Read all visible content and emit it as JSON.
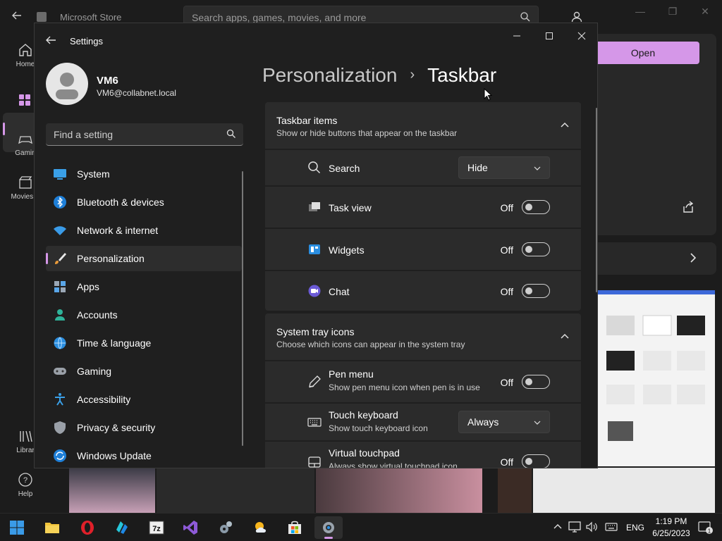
{
  "store": {
    "title": "Microsoft Store",
    "search_placeholder": "Search apps, games, movies, and more",
    "nav": [
      {
        "label": "Home",
        "icon": "home-icon"
      },
      {
        "label": "Apps",
        "icon": "apps-icon"
      },
      {
        "label": "Gamin",
        "icon": "gaming-controller-icon"
      },
      {
        "label": "Movies &",
        "icon": "movies-icon"
      },
      {
        "label": "Librar",
        "icon": "library-icon"
      },
      {
        "label": "Help",
        "icon": "help-icon"
      }
    ],
    "open_label": "Open",
    "accent_color": "#d597e8"
  },
  "settings": {
    "title": "Settings",
    "profile": {
      "name": "VM6",
      "email": "VM6@collabnet.local"
    },
    "search_placeholder": "Find a setting",
    "nav": [
      {
        "label": "System",
        "icon": "monitor-icon"
      },
      {
        "label": "Bluetooth & devices",
        "icon": "bluetooth-icon"
      },
      {
        "label": "Network & internet",
        "icon": "wifi-icon"
      },
      {
        "label": "Personalization",
        "icon": "brush-icon",
        "active": true
      },
      {
        "label": "Apps",
        "icon": "apps-icon"
      },
      {
        "label": "Accounts",
        "icon": "person-icon"
      },
      {
        "label": "Time & language",
        "icon": "globe-clock-icon"
      },
      {
        "label": "Gaming",
        "icon": "gamepad-icon"
      },
      {
        "label": "Accessibility",
        "icon": "accessibility-icon"
      },
      {
        "label": "Privacy & security",
        "icon": "shield-icon"
      },
      {
        "label": "Windows Update",
        "icon": "update-icon"
      }
    ],
    "breadcrumb": {
      "parent": "Personalization",
      "separator": "›",
      "current": "Taskbar"
    },
    "sections": {
      "taskbar_items": {
        "title": "Taskbar items",
        "subtitle": "Show or hide buttons that appear on the taskbar",
        "rows": [
          {
            "label": "Search",
            "icon": "search-icon",
            "control": "dropdown",
            "value": "Hide"
          },
          {
            "label": "Task view",
            "icon": "task-view-icon",
            "control": "toggle",
            "state": "Off"
          },
          {
            "label": "Widgets",
            "icon": "widgets-icon",
            "control": "toggle",
            "state": "Off"
          },
          {
            "label": "Chat",
            "icon": "chat-icon",
            "control": "toggle",
            "state": "Off"
          }
        ]
      },
      "system_tray": {
        "title": "System tray icons",
        "subtitle": "Choose which icons can appear in the system tray",
        "rows": [
          {
            "label": "Pen menu",
            "sublabel": "Show pen menu icon when pen is in use",
            "icon": "pen-icon",
            "control": "toggle",
            "state": "Off"
          },
          {
            "label": "Touch keyboard",
            "sublabel": "Show touch keyboard icon",
            "icon": "keyboard-icon",
            "control": "dropdown",
            "value": "Always"
          },
          {
            "label": "Virtual touchpad",
            "sublabel": "Always show virtual touchpad icon",
            "icon": "touchpad-icon",
            "control": "toggle",
            "state": "Off"
          }
        ]
      }
    }
  },
  "taskbar": {
    "apps": [
      {
        "name": "Start",
        "icon": "windows-start-icon"
      },
      {
        "name": "File Explorer",
        "icon": "folder-icon"
      },
      {
        "name": "Opera",
        "icon": "opera-icon"
      },
      {
        "name": "App",
        "icon": "blue-app-icon"
      },
      {
        "name": "7-Zip",
        "icon": "7zip-icon",
        "text": "7z"
      },
      {
        "name": "Visual Studio",
        "icon": "visual-studio-icon"
      },
      {
        "name": "Control Panel",
        "icon": "control-panel-icon"
      },
      {
        "name": "Weather",
        "icon": "weather-icon"
      },
      {
        "name": "Microsoft Store",
        "icon": "store-icon"
      },
      {
        "name": "Settings",
        "icon": "settings-gear-icon",
        "active": true
      }
    ],
    "tray": {
      "language": "ENG",
      "time": "1:19 PM",
      "date": "6/25/2023",
      "notifications": "1"
    }
  }
}
